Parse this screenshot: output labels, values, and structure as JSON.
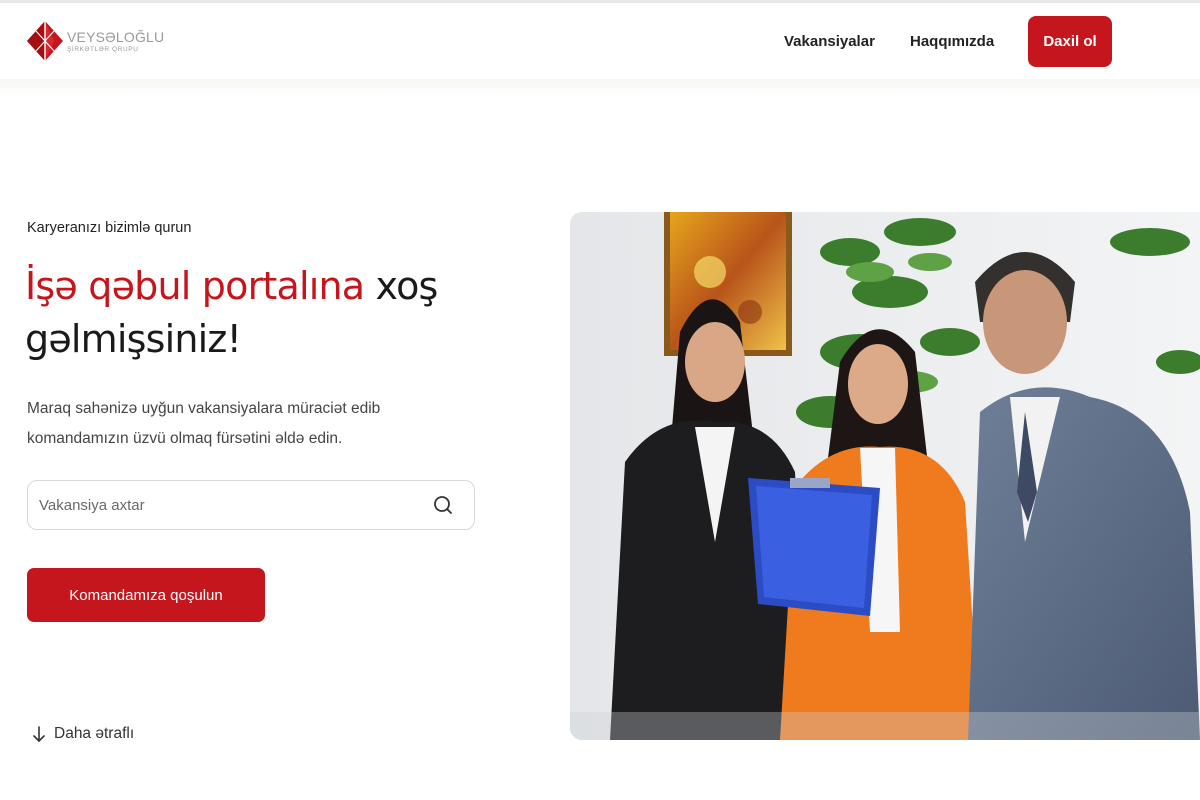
{
  "brand": {
    "name": "VEYSƏLOĞLU",
    "subtitle": "ŞİRKƏTLƏR QRUPU",
    "accent_color": "#c4161c"
  },
  "nav": {
    "links": [
      "Vakansiyalar",
      "Haqqımızda"
    ],
    "login_label": "Daxil ol"
  },
  "hero": {
    "eyebrow": "Karyeranızı bizimlə qurun",
    "title_accent": "İşə qəbul portalına",
    "title_rest": " xoş gəlmişsiniz!",
    "lead": "Maraq sahənizə uyğun vakansiyalara müraciət edib komandamızın üzvü olmaq fürsətini əldə edin.",
    "search_placeholder": "Vakansiya axtar",
    "join_label": "Komandamıza qoşulun",
    "more_label": "Daha ətraflı",
    "image_alt": "Three team members in office"
  },
  "icons": {
    "logo": "diamond-logo-icon",
    "search": "search-icon",
    "more": "arrow-down-icon"
  }
}
